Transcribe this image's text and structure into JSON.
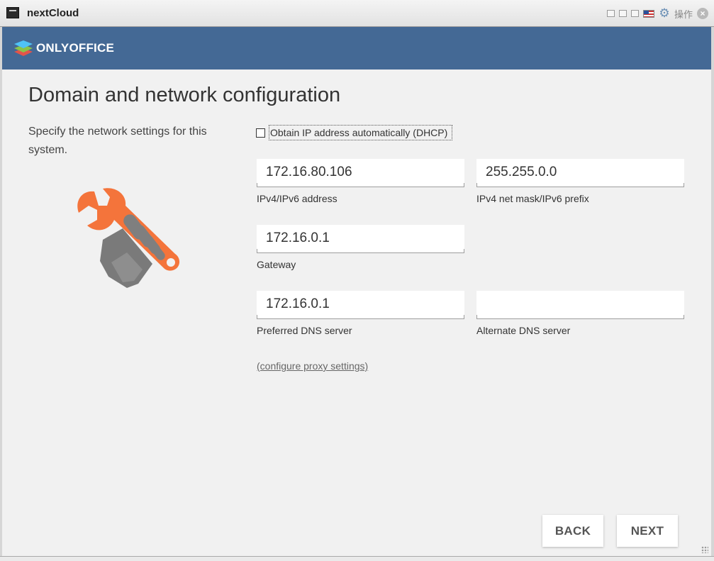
{
  "window": {
    "title": "nextCloud",
    "controls_text": "操作"
  },
  "brand": {
    "logo_text": "ONLYOFFICE",
    "header_color": "#446995"
  },
  "page": {
    "title": "Domain and network configuration",
    "description": "Specify the network settings for this system."
  },
  "dhcp": {
    "label": "Obtain IP address automatically (DHCP)",
    "checked": false
  },
  "fields": {
    "ip": {
      "value": "172.16.80.106",
      "label": "IPv4/IPv6 address"
    },
    "mask": {
      "value": "255.255.0.0",
      "label": "IPv4 net mask/IPv6 prefix"
    },
    "gateway": {
      "value": "172.16.0.1",
      "label": "Gateway"
    },
    "dns1": {
      "value": "172.16.0.1",
      "label": "Preferred DNS server"
    },
    "dns2": {
      "value": "",
      "label": "Alternate DNS server"
    }
  },
  "proxy_link": "(configure proxy settings)",
  "buttons": {
    "back": "BACK",
    "next": "NEXT"
  },
  "colors": {
    "accent_orange": "#f4743b",
    "icon_gray": "#808080"
  }
}
